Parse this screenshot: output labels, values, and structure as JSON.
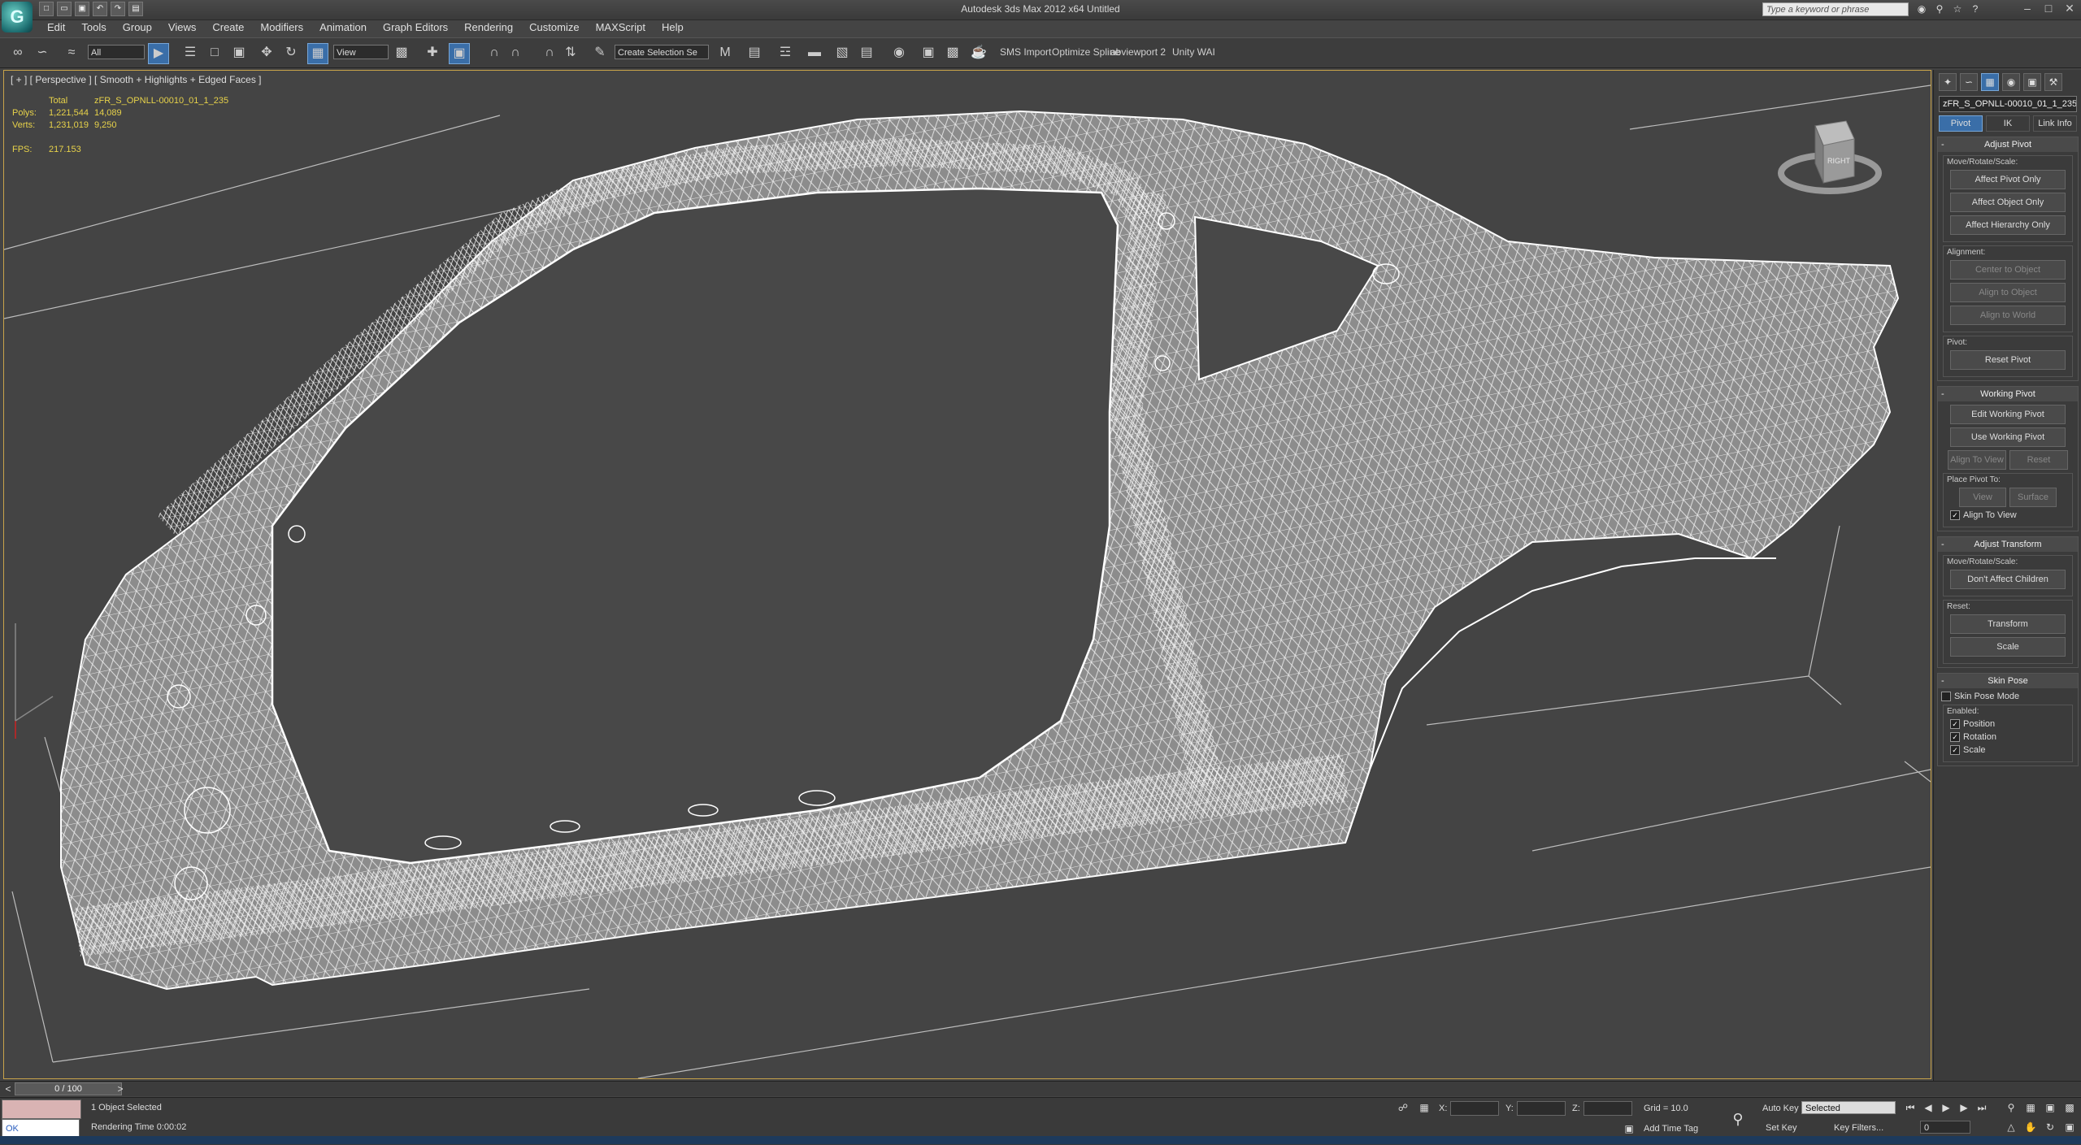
{
  "window": {
    "title": "Autodesk 3ds Max  2012 x64      Untitled",
    "logo": "3ds-max-logo"
  },
  "search": {
    "placeholder": "Type a keyword or phrase"
  },
  "menu": [
    "Edit",
    "Tools",
    "Group",
    "Views",
    "Create",
    "Modifiers",
    "Animation",
    "Graph Editors",
    "Rendering",
    "Customize",
    "MAXScript",
    "Help"
  ],
  "toolbar": {
    "filter_value": "All",
    "refcoord_value": "View",
    "selection_set": "Create Selection Se",
    "scripts": [
      "SMS Import",
      "Optimize Spline",
      "abviewport 2",
      "Unity WAI"
    ]
  },
  "viewport": {
    "label": "[ + ] [ Perspective ] [ Smooth + Highlights + Edged Faces ]",
    "stats": {
      "header_total": "Total",
      "header_object": "zFR_S_OPNLL-00010_01_1_235",
      "polys_label": "Polys:",
      "polys_total": "1,221,544",
      "polys_object": "14,089",
      "verts_label": "Verts:",
      "verts_total": "1,231,019",
      "verts_object": "9,250",
      "fps_label": "FPS:",
      "fps_value": "217.153"
    },
    "viewcube_label": "RIGHT"
  },
  "command_panel": {
    "object_name": "zFR_S_OPNLL-00010_01_1_235",
    "subtabs": [
      "Pivot",
      "IK",
      "Link Info"
    ],
    "adjust_pivot": {
      "title": "Adjust Pivot",
      "move_group": "Move/Rotate/Scale:",
      "buttons": [
        "Affect Pivot Only",
        "Affect Object Only",
        "Affect Hierarchy Only"
      ],
      "alignment_group": "Alignment:",
      "align_buttons": [
        "Center to Object",
        "Align to Object",
        "Align to World"
      ],
      "pivot_group": "Pivot:",
      "reset_pivot": "Reset Pivot"
    },
    "working_pivot": {
      "title": "Working Pivot",
      "edit": "Edit Working Pivot",
      "use": "Use Working Pivot",
      "align_to_view": "Align To View",
      "reset": "Reset",
      "place_group": "Place Pivot To:",
      "view": "View",
      "surface": "Surface",
      "align_check": "Align To View"
    },
    "adjust_transform": {
      "title": "Adjust Transform",
      "move_group": "Move/Rotate/Scale:",
      "dont_affect": "Don't Affect Children",
      "reset_group": "Reset:",
      "transform": "Transform",
      "scale": "Scale"
    },
    "skin_pose": {
      "title": "Skin Pose",
      "mode": "Skin Pose Mode",
      "enabled": "Enabled:",
      "position": "Position",
      "rotation": "Rotation",
      "scale": "Scale"
    }
  },
  "timeline": {
    "frame": "0 / 100"
  },
  "status": {
    "selected": "1 Object Selected",
    "rendering_time": "Rendering Time  0:00:02",
    "mxs_output": "OK",
    "x_label": "X:",
    "y_label": "Y:",
    "z_label": "Z:",
    "grid": "Grid = 10.0",
    "add_time_tag": "Add Time Tag",
    "auto_key": "Auto Key",
    "set_key": "Set Key",
    "key_mode": "Selected",
    "key_filters": "Key Filters...",
    "frame_field": "0"
  }
}
